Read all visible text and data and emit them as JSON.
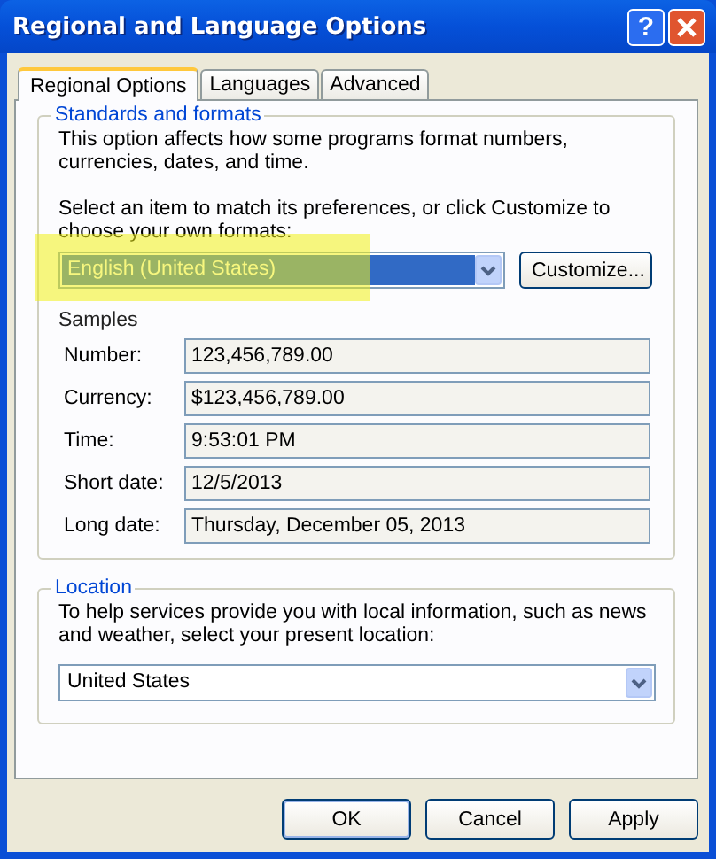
{
  "window": {
    "title": "Regional and Language Options",
    "help_button": "?"
  },
  "tabs": [
    {
      "label": "Regional Options",
      "selected": true
    },
    {
      "label": "Languages",
      "selected": false
    },
    {
      "label": "Advanced",
      "selected": false
    }
  ],
  "standards": {
    "title": "Standards and formats",
    "description": "This option affects how some programs format numbers, currencies, dates, and time.",
    "prompt": "Select an item to match its preferences, or click Customize to choose your own formats:",
    "format_select": {
      "value": "English (United States)",
      "selected": true
    },
    "customize_button": "Customize...",
    "samples": {
      "title": "Samples",
      "rows": [
        {
          "label": "Number:",
          "value": "123,456,789.00"
        },
        {
          "label": "Currency:",
          "value": "$123,456,789.00"
        },
        {
          "label": "Time:",
          "value": "9:53:01 PM"
        },
        {
          "label": "Short date:",
          "value": "12/5/2013"
        },
        {
          "label": "Long date:",
          "value": "Thursday, December 05, 2013"
        }
      ]
    }
  },
  "location": {
    "title": "Location",
    "description": "To help services provide you with local information, such as news and weather, select your present location:",
    "select": {
      "value": "United States"
    }
  },
  "buttons": [
    {
      "label": "OK",
      "default": true
    },
    {
      "label": "Cancel",
      "default": false
    },
    {
      "label": "Apply",
      "default": false
    }
  ]
}
